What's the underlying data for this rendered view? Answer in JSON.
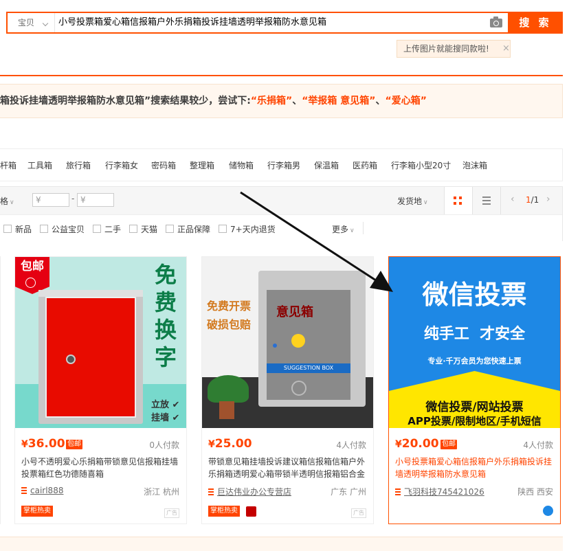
{
  "search": {
    "scope_label": "宝贝",
    "query": "小号投票箱爱心箱信报箱户外乐捐箱投诉挂墙透明举报箱防水意见箱",
    "button_label": "搜 索",
    "tip_text": "上传图片就能搜同款啦!",
    "tip_close": "×"
  },
  "suggestion": {
    "prefix": "箱投诉挂墙透明举报箱防水意见箱”搜索结果较少，尝试下:",
    "keywords": [
      "“乐捐箱”",
      "“举报箱 意见箱”",
      "“爱心箱”"
    ],
    "separator": "、"
  },
  "related": [
    "杆箱",
    "工具箱",
    "旅行箱",
    "行李箱女",
    "密码箱",
    "整理箱",
    "储物箱",
    "行李箱男",
    "保温箱",
    "医药箱",
    "行李箱小型20寸",
    "泡沫箱"
  ],
  "filter": {
    "sort_fragment": "格",
    "price_min_placeholder": "¥",
    "price_max_placeholder": "¥",
    "price_dash": "-",
    "ship_from": "发货地",
    "page": "1",
    "pages": "/1",
    "checkboxes": [
      "新品",
      "公益宝贝",
      "二手",
      "天猫",
      "正品保障",
      "7+天内退货"
    ],
    "more": "更多"
  },
  "products": [
    {
      "price_symbol": "¥",
      "price": "36.00",
      "baoyou": "包邮",
      "paid": "0人付款",
      "title": "小号不透明爱心乐捐箱带锁意见信报箱挂墙投票箱红色功德随喜箱",
      "shop": "cairl888",
      "location": "浙江 杭州",
      "tag": "掌柜热卖",
      "ad": "广告",
      "img_text": {
        "corner": "包邮",
        "big": [
          "免",
          "费",
          "换",
          "字"
        ],
        "opt1": "立放",
        "opt2": "挂墙"
      }
    },
    {
      "price_symbol": "¥",
      "price": "25.00",
      "paid": "4人付款",
      "title": "带锁意见箱挂墙投诉建议箱信报箱信箱户外乐捐箱透明爱心箱带锁半透明信报箱铝合金",
      "shop": "巨达伟业办公专营店",
      "location": "广东 广州",
      "tag": "掌柜热卖",
      "ad": "广告",
      "img_text": {
        "line1": "免费开票",
        "line2": "破损包赔",
        "box_label": "意见箱",
        "slot": "SUGGESTION BOX"
      }
    },
    {
      "price_symbol": "¥",
      "price": "20.00",
      "baoyou": "包邮",
      "paid": "4人付款",
      "title": "小号投票箱爱心箱信报箱户外乐捐箱投诉挂墙透明举报箱防水意见箱",
      "shop": "飞羽科技745421026",
      "location": "陕西 西安",
      "img_text": {
        "l1": "微信投票",
        "l2": "纯手工  才安全",
        "l3": "专业·千万会员为您快速上票",
        "l4": "微信投票/网站投票",
        "l5": "APP投票/限制地区/手机短信"
      }
    }
  ],
  "colors": {
    "accent": "#ff5000",
    "price": "#ff4400"
  }
}
